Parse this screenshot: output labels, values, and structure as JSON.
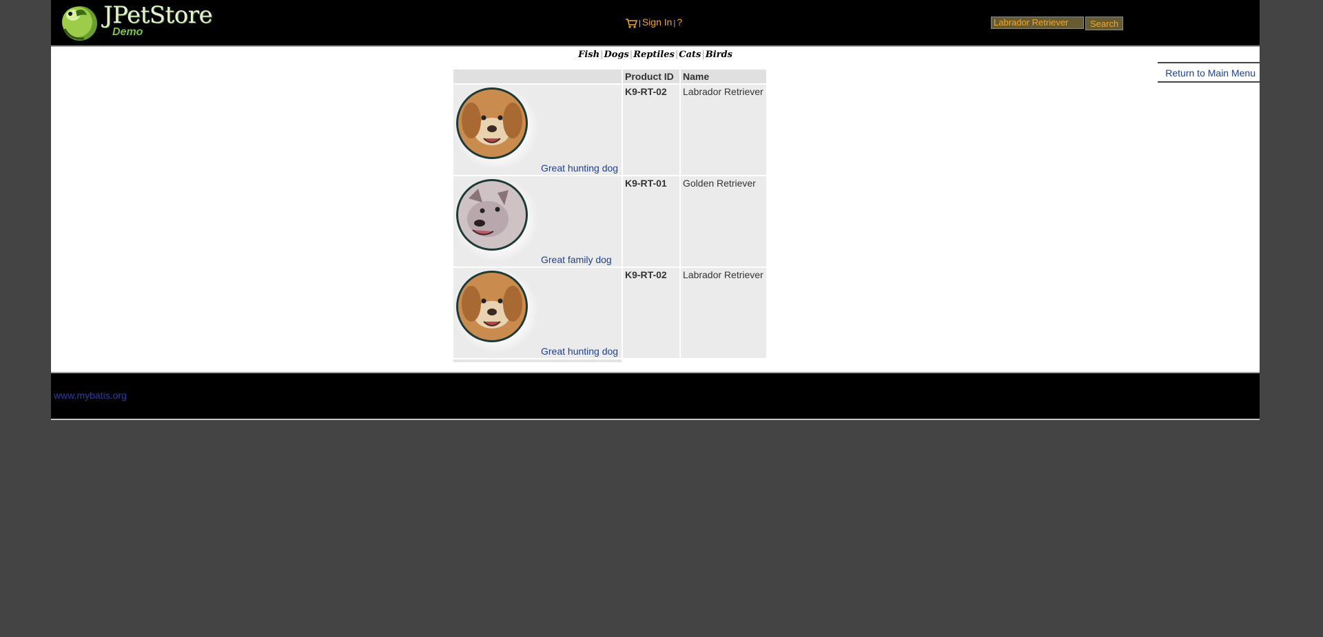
{
  "header": {
    "logo": {
      "brand": "JPetStore",
      "sub": "Demo"
    },
    "menu": {
      "signin": "Sign In",
      "help": "?"
    },
    "search": {
      "value": "Labrador Retriever",
      "button": "Search"
    }
  },
  "quicklinks": [
    "Fish",
    "Dogs",
    "Reptiles",
    "Cats",
    "Birds"
  ],
  "return_link": "Return to Main Menu",
  "table": {
    "headers": [
      "",
      "Product ID",
      "Name"
    ],
    "rows": [
      {
        "description": "Great hunting dog",
        "product_id": "K9-RT-02",
        "name": "Labrador Retriever"
      },
      {
        "description": "Great family dog",
        "product_id": "K9-RT-01",
        "name": "Golden Retriever"
      },
      {
        "description": "Great hunting dog",
        "product_id": "K9-RT-02",
        "name": "Labrador Retriever"
      }
    ]
  },
  "footer": {
    "link": "www.mybatis.org"
  },
  "colors": {
    "accent": "#f5a623",
    "link": "#1f3f8f",
    "header_bg": "#000000",
    "page_bg": "#444444"
  }
}
